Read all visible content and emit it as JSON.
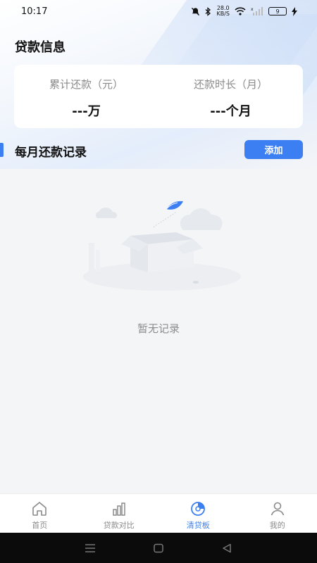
{
  "status_bar": {
    "time": "10:17",
    "network_speed_value": "28.0",
    "network_speed_unit": "KB/S",
    "signal_label": "x",
    "battery": "9",
    "icons": [
      "mute-icon",
      "bluetooth-icon",
      "wifi-icon",
      "signal-icon",
      "battery-icon",
      "charging-icon"
    ]
  },
  "header": {
    "title": "贷款信息"
  },
  "summary": {
    "total_repaid_label": "累计还款（元）",
    "total_repaid_value": "---万",
    "duration_label": "还款时长（月）",
    "duration_value": "---个月"
  },
  "records": {
    "title": "每月还款记录",
    "add_label": "添加",
    "empty_text": "暂无记录"
  },
  "tabs": [
    {
      "label": "首页",
      "icon": "home-icon",
      "active": false
    },
    {
      "label": "贷款对比",
      "icon": "bar-chart-icon",
      "active": false
    },
    {
      "label": "清贷板",
      "icon": "clear-loan-icon",
      "active": true
    },
    {
      "label": "我的",
      "icon": "user-icon",
      "active": false
    }
  ],
  "colors": {
    "accent": "#3b7ff2",
    "background": "#f4f5f7",
    "muted_text": "#8a8a8a"
  }
}
